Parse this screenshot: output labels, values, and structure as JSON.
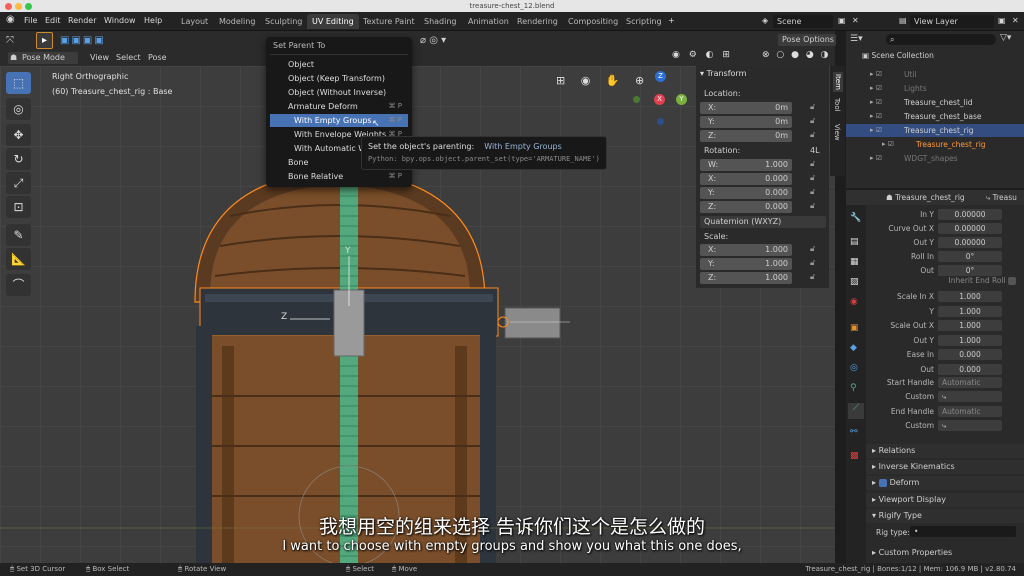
{
  "window": {
    "title": "treasure-chest_12.blend"
  },
  "menubar": {
    "items": [
      "File",
      "Edit",
      "Render",
      "Window",
      "Help"
    ],
    "workspaces": [
      "Layout",
      "Modeling",
      "Sculpting",
      "UV Editing",
      "Texture Paint",
      "Shading",
      "Animation",
      "Rendering",
      "Compositing",
      "Scripting"
    ],
    "active_workspace": "UV Editing",
    "scene": "Scene",
    "view_layer": "View Layer"
  },
  "viewport_header": {
    "mode": "Pose Mode",
    "menus": [
      "View",
      "Select",
      "Pose"
    ],
    "pose_options": "Pose Options"
  },
  "viewport": {
    "view_name": "Right Orthographic",
    "object_info": "(60) Treasure_chest_rig : Base",
    "axis_y": "Y",
    "axis_z": "Z",
    "gizmo_x": "X",
    "gizmo_y": "Y",
    "gizmo_z": "Z"
  },
  "menu": {
    "title": "Set Parent To",
    "items": [
      {
        "label": "Object",
        "shortcut": ""
      },
      {
        "label": "Object (Keep Transform)",
        "shortcut": ""
      },
      {
        "label": "Object (Without Inverse)",
        "shortcut": ""
      },
      {
        "label": "Armature Deform",
        "shortcut": "⌘ P"
      },
      {
        "label": "With Empty Groups",
        "shortcut": "⌘ P"
      },
      {
        "label": "With Envelope Weights",
        "shortcut": "⌘ P"
      },
      {
        "label": "With Automatic Weights",
        "shortcut": "⌘ P"
      },
      {
        "label": "Bone",
        "shortcut": "⌘ P"
      },
      {
        "label": "Bone Relative",
        "shortcut": "⌘ P"
      }
    ]
  },
  "tooltip": {
    "label": "Set the object's parenting:",
    "value": "With Empty Groups",
    "python": "Python: bpy.ops.object.parent_set(type='ARMATURE_NAME')"
  },
  "npanel": {
    "header": "Transform",
    "tabs": [
      "Item",
      "Tool",
      "View"
    ],
    "location_label": "Location:",
    "location": [
      {
        "axis": "X:",
        "value": "0m"
      },
      {
        "axis": "Y:",
        "value": "0m"
      },
      {
        "axis": "Z:",
        "value": "0m"
      }
    ],
    "rotation_label": "Rotation:",
    "rotation_mode_short": "4L",
    "rotation": [
      {
        "axis": "W:",
        "value": "1.000"
      },
      {
        "axis": "X:",
        "value": "0.000"
      },
      {
        "axis": "Y:",
        "value": "0.000"
      },
      {
        "axis": "Z:",
        "value": "0.000"
      }
    ],
    "rotation_mode": "Quaternion (WXYZ)",
    "scale_label": "Scale:",
    "scale": [
      {
        "axis": "X:",
        "value": "1.000"
      },
      {
        "axis": "Y:",
        "value": "1.000"
      },
      {
        "axis": "Z:",
        "value": "1.000"
      }
    ]
  },
  "outliner": {
    "root": "Scene Collection",
    "items": [
      {
        "label": "Util",
        "dim": true,
        "sel": false
      },
      {
        "label": "Lights",
        "dim": true,
        "sel": false
      },
      {
        "label": "Treasure_chest_lid",
        "dim": false,
        "sel": false
      },
      {
        "label": "Treasure_chest_base",
        "dim": false,
        "sel": false
      },
      {
        "label": "Treasure_chest_rig",
        "dim": false,
        "sel": true
      },
      {
        "label": "Treasure_chest_rig",
        "dim": false,
        "sel": false,
        "orange": true
      },
      {
        "label": "WDGT_shapes",
        "dim": true,
        "sel": false
      }
    ]
  },
  "properties": {
    "header_object": "Treasure_chest_rig",
    "header_bone": "Treasu",
    "fields": [
      {
        "label": "In Y",
        "value": "0.00000"
      },
      {
        "label": "Curve Out X",
        "value": "0.00000"
      },
      {
        "label": "Out Y",
        "value": "0.00000"
      },
      {
        "label": "Roll In",
        "value": "0°"
      },
      {
        "label": "Out",
        "value": "0°"
      }
    ],
    "inherit_end_roll": "Inherit End Roll",
    "fields2": [
      {
        "label": "Scale In X",
        "value": "1.000"
      },
      {
        "label": "Y",
        "value": "1.000"
      },
      {
        "label": "Scale Out X",
        "value": "1.000"
      },
      {
        "label": "Out Y",
        "value": "1.000"
      },
      {
        "label": "Ease In",
        "value": "0.000"
      },
      {
        "label": "Out",
        "value": "0.000"
      }
    ],
    "start_handle_label": "Start Handle",
    "start_handle": "Automatic",
    "custom_label": "Custom",
    "end_handle_label": "End Handle",
    "end_handle": "Automatic",
    "custom_label2": "Custom",
    "sections": [
      "Relations",
      "Inverse Kinematics",
      "Deform",
      "Viewport Display",
      "Rigify Type"
    ],
    "rig_type_label": "Rig type:",
    "rig_type_value": "•",
    "custom_properties": "Custom Properties"
  },
  "statusbar": {
    "left": [
      "Set 3D Cursor",
      "Box Select",
      "Rotate View"
    ],
    "mid": [
      "Select",
      "Move"
    ],
    "right": "Treasure_chest_rig | Bones:1/12 | Mem: 106.9 MB | v2.80.74"
  },
  "subtitles": {
    "zh": "我想用空的组来选择 告诉你们这个是怎么做的",
    "en": "I want to choose with empty groups and show you what this one does,"
  },
  "colors": {
    "accent": "#4772b3",
    "orange": "#ff8a1a",
    "bone_green": "#4fb386"
  }
}
